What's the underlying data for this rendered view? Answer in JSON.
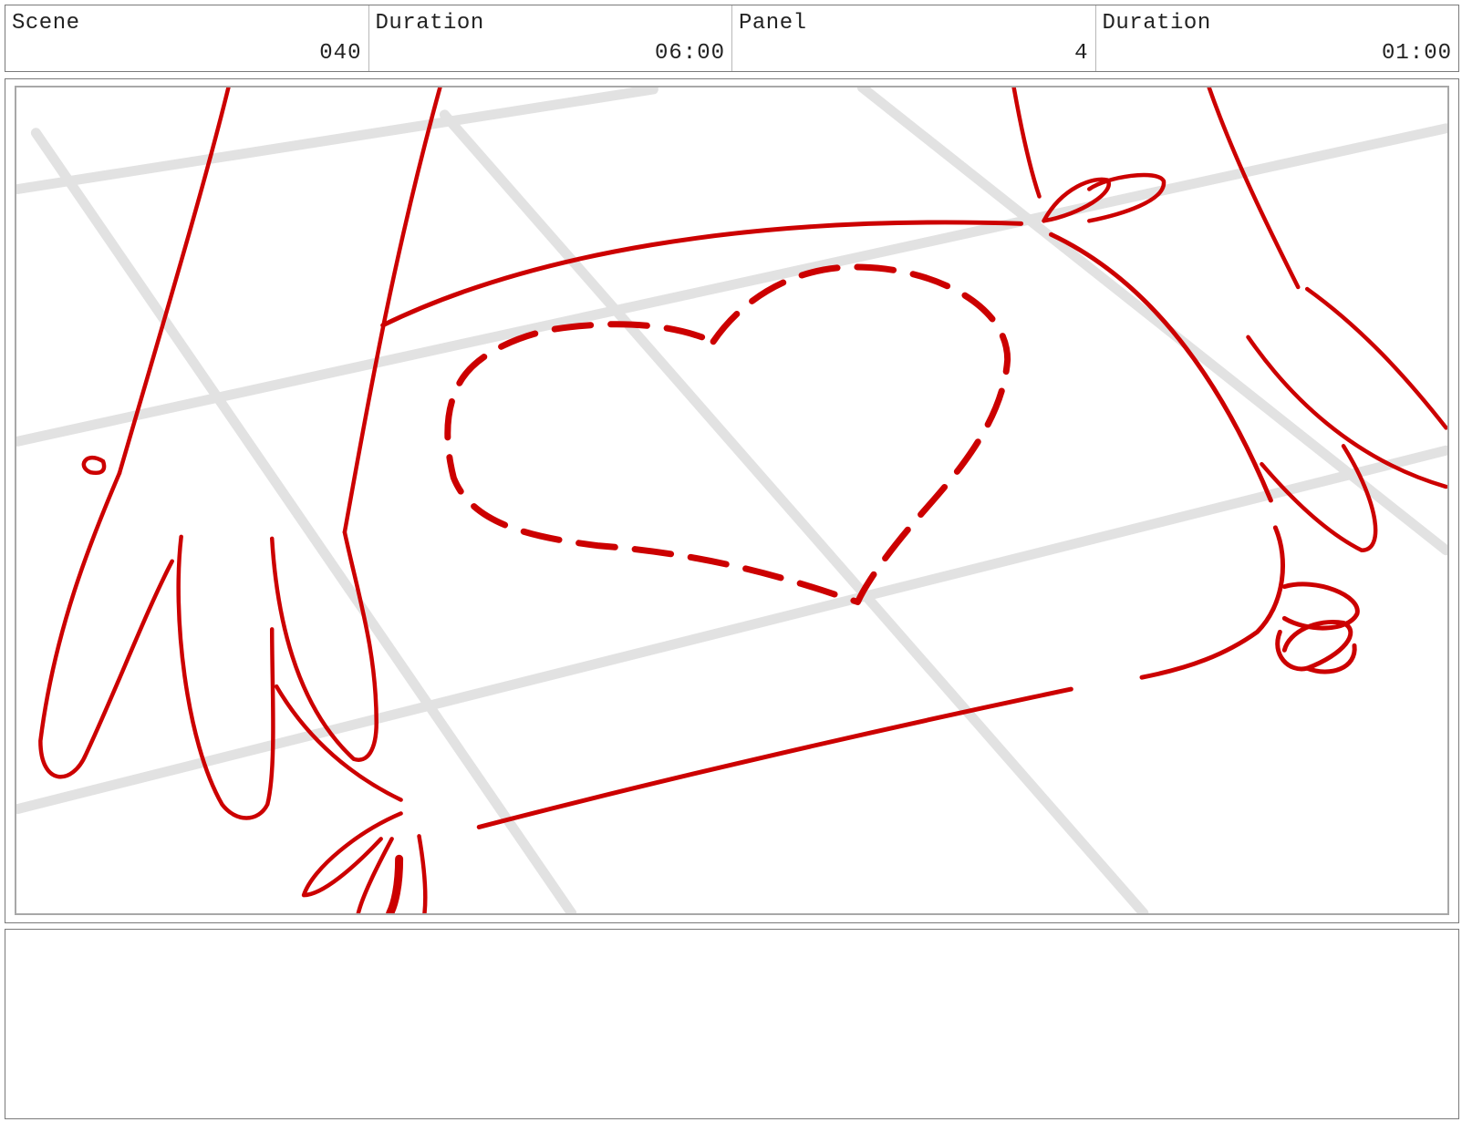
{
  "header": {
    "scene": {
      "label": "Scene",
      "value": "040"
    },
    "scene_duration": {
      "label": "Duration",
      "value": "06:00"
    },
    "panel": {
      "label": "Panel",
      "value": "4"
    },
    "panel_duration": {
      "label": "Duration",
      "value": "01:00"
    }
  },
  "sketch": {
    "stroke_color": "#cc0000",
    "grid_color": "#e2e2e2",
    "frame_color": "#a8a8a8"
  },
  "notes": {
    "text": ""
  }
}
